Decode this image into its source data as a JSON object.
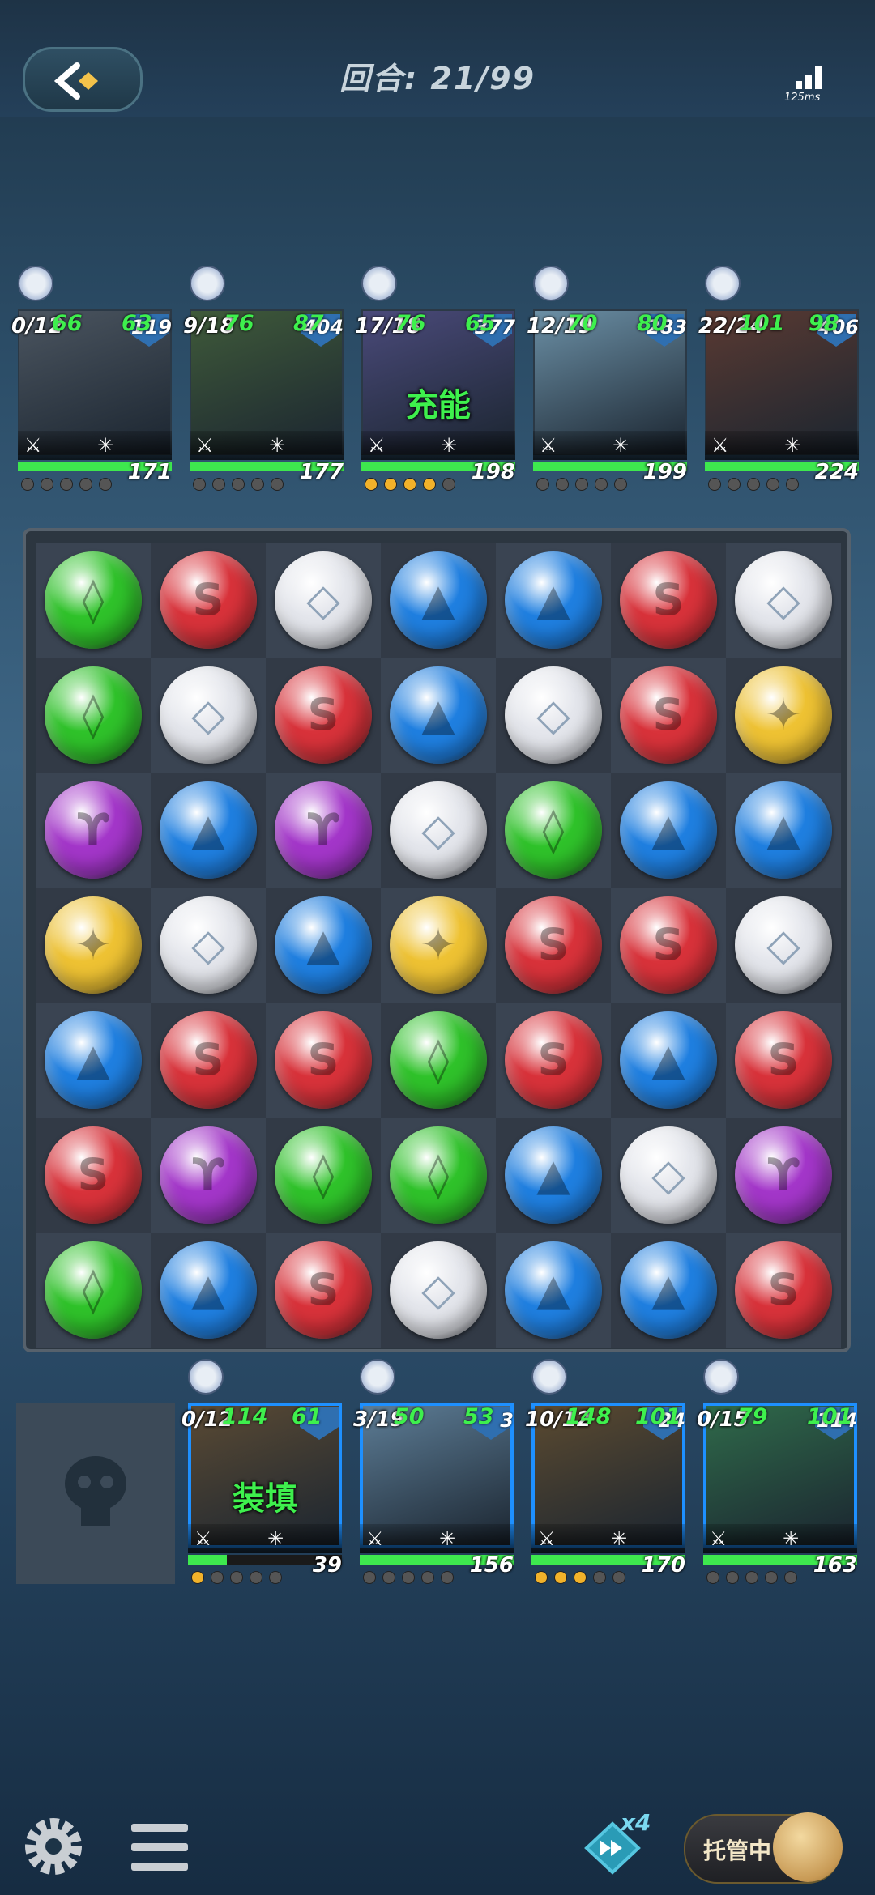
{
  "header": {
    "round_label": "回合: 21/99",
    "latency": "125ms"
  },
  "enemies": [
    {
      "energy": "0/12",
      "defense": "119",
      "attack": "66",
      "magic": "63",
      "hp": "171",
      "hp_frac": 1.0,
      "charge_dots": 0,
      "boost_label": ""
    },
    {
      "energy": "9/18",
      "defense": "404",
      "attack": "76",
      "magic": "87",
      "hp": "177",
      "hp_frac": 1.0,
      "charge_dots": 0,
      "boost_label": ""
    },
    {
      "energy": "17/18",
      "defense": "377",
      "attack": "76",
      "magic": "65",
      "hp": "198",
      "hp_frac": 1.0,
      "charge_dots": 4,
      "boost_label": "充能"
    },
    {
      "energy": "12/19",
      "defense": "283",
      "attack": "70",
      "magic": "80",
      "hp": "199",
      "hp_frac": 1.0,
      "charge_dots": 0,
      "boost_label": ""
    },
    {
      "energy": "22/24",
      "defense": "406",
      "attack": "101",
      "magic": "98",
      "hp": "224",
      "hp_frac": 1.0,
      "charge_dots": 0,
      "boost_label": ""
    }
  ],
  "players": [
    {
      "energy": "0/12",
      "defense": "",
      "attack": "114",
      "magic": "61",
      "hp": "39",
      "hp_frac": 0.25,
      "charge_dots": 1,
      "boost_label": "装填"
    },
    {
      "energy": "3/19",
      "defense": "3",
      "attack": "50",
      "magic": "53",
      "hp": "156",
      "hp_frac": 1.0,
      "charge_dots": 0,
      "boost_label": ""
    },
    {
      "energy": "10/12",
      "defense": "24",
      "attack": "148",
      "magic": "101",
      "hp": "170",
      "hp_frac": 1.0,
      "charge_dots": 3,
      "boost_label": ""
    },
    {
      "energy": "0/15",
      "defense": "114",
      "attack": "79",
      "magic": "101",
      "hp": "163",
      "hp_frac": 1.0,
      "charge_dots": 0,
      "boost_label": ""
    }
  ],
  "board": {
    "rows": [
      [
        "green",
        "red",
        "white",
        "blue",
        "blue",
        "red",
        "white"
      ],
      [
        "green",
        "white",
        "red",
        "blue",
        "white",
        "red",
        "yellow"
      ],
      [
        "purple",
        "blue",
        "purple",
        "white",
        "green",
        "blue",
        "blue"
      ],
      [
        "yellow",
        "white",
        "blue",
        "yellow",
        "red",
        "red",
        "white"
      ],
      [
        "blue",
        "red",
        "red",
        "green",
        "red",
        "blue",
        "red"
      ],
      [
        "red",
        "purple",
        "green",
        "green",
        "blue",
        "white",
        "purple"
      ],
      [
        "green",
        "blue",
        "red",
        "white",
        "blue",
        "blue",
        "red"
      ]
    ],
    "colors": {
      "green": "#2fc22a",
      "red": "#d8323a",
      "white": "#e4e6ec",
      "blue": "#1f7fe0",
      "purple": "#a336c9",
      "yellow": "#eec233"
    },
    "glyphs": {
      "green": "◊",
      "red": "S",
      "white": "◇",
      "blue": "▲",
      "purple": "ϒ",
      "yellow": "✦"
    }
  },
  "footer": {
    "speed": "x4",
    "auto_label": "托管中"
  }
}
